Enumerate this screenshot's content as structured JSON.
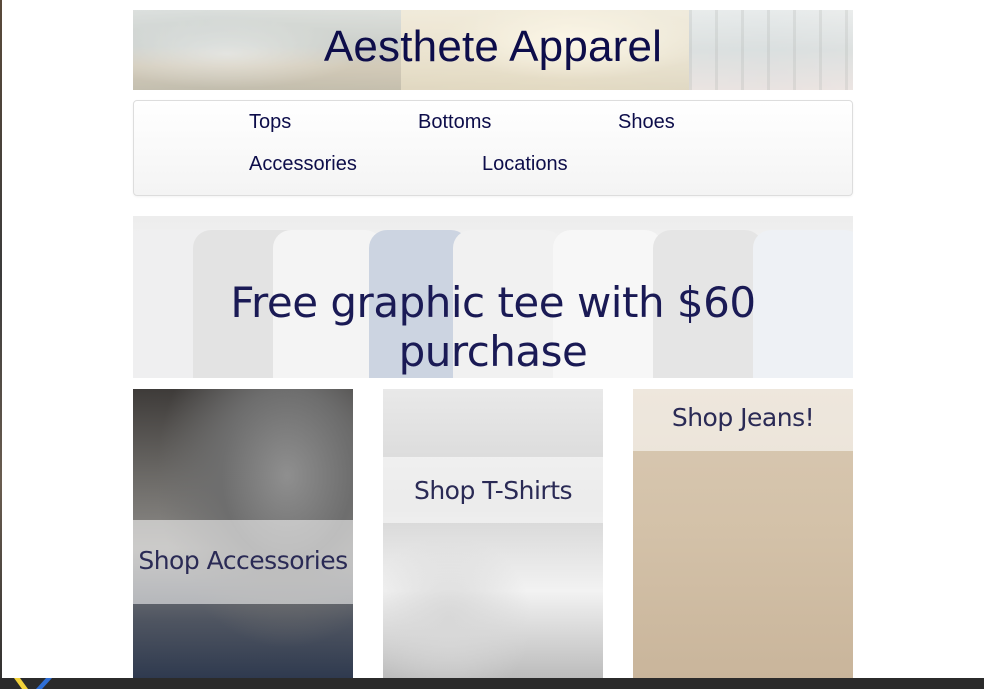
{
  "brand": {
    "title": "Aesthete Apparel"
  },
  "nav": {
    "items": [
      {
        "label": "Tops"
      },
      {
        "label": "Bottoms"
      },
      {
        "label": "Shoes"
      },
      {
        "label": "Accessories"
      },
      {
        "label": "Locations"
      }
    ]
  },
  "promo": {
    "text": "Free graphic tee with $60 purchase"
  },
  "tiles": [
    {
      "label": "Shop Accessories"
    },
    {
      "label": "Shop T-Shirts"
    },
    {
      "label": "Shop Jeans!"
    }
  ],
  "colors": {
    "text": "#0d0d4a",
    "nav_border": "#dddddd",
    "taskbar": "#2b2b2b"
  }
}
